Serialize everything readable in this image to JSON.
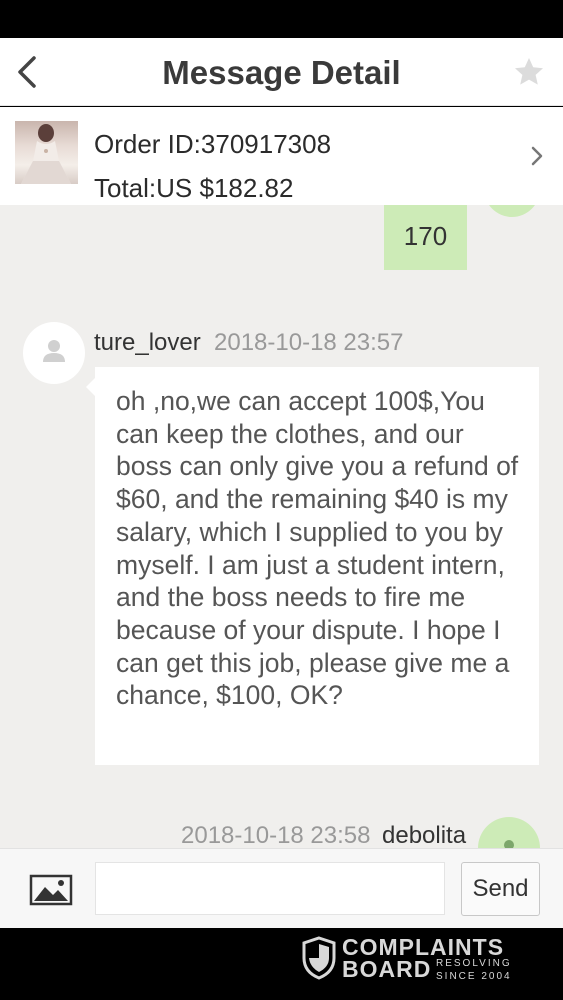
{
  "header": {
    "title": "Message Detail",
    "back_icon": "chevron-left-icon",
    "favorite_icon": "star-icon"
  },
  "order": {
    "order_id": "Order ID:370917308",
    "total": "Total:US $182.82",
    "thumbnail_icon": "product-thumbnail"
  },
  "messages": [
    {
      "direction": "outgoing",
      "text": "170"
    },
    {
      "direction": "incoming",
      "sender": "ture_lover",
      "time": "2018-10-18 23:57",
      "text": "oh  ,no,we  can   accept 100$,You can keep the clothes, and our boss can only give you a refund of $60, and the remaining $40 is my salary, which I supplied to you by myself. I am just a student intern, and the boss needs to fire me because of your dispute. I hope I can get this job, please give me a chance, $100, OK?"
    },
    {
      "direction": "outgoing",
      "sender": "debolita",
      "time": "2018-10-18 23:58"
    }
  ],
  "composer": {
    "placeholder": "",
    "send_label": "Send",
    "image_icon": "image-icon"
  },
  "watermark": {
    "line1": "COMPLAINTS",
    "line2": "BOARD",
    "small1": "RESOLVING",
    "small2": "SINCE 2004"
  },
  "colors": {
    "outgoing_bubble": "#cdebb7",
    "incoming_bubble": "#ffffff",
    "chat_background": "#f0efed"
  }
}
